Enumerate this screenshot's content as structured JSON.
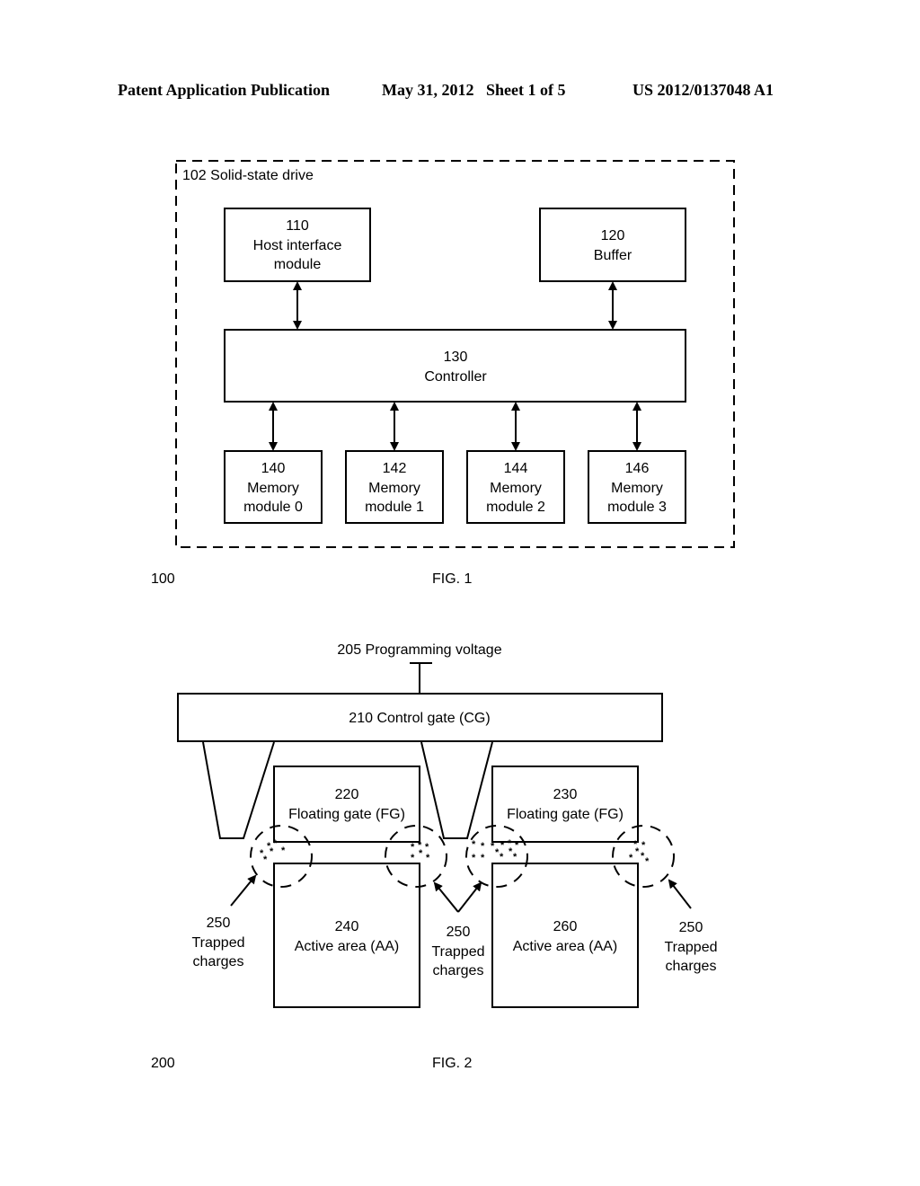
{
  "header": {
    "publication": "Patent Application Publication",
    "date_sheet": "May 31, 2012   Sheet 1 of 5",
    "number": "US 2012/0137048 A1"
  },
  "fig1": {
    "container_label": "102 Solid-state drive",
    "host_interface": {
      "num": "110",
      "line1": "Host interface",
      "line2": "module"
    },
    "buffer": {
      "num": "120",
      "label": "Buffer"
    },
    "controller": {
      "num": "130",
      "label": "Controller"
    },
    "memory_modules": [
      {
        "num": "140",
        "line1": "Memory",
        "line2": "module 0"
      },
      {
        "num": "142",
        "line1": "Memory",
        "line2": "module 1"
      },
      {
        "num": "144",
        "line1": "Memory",
        "line2": "module 2"
      },
      {
        "num": "146",
        "line1": "Memory",
        "line2": "module 3"
      }
    ],
    "ref_number": "100",
    "caption": "FIG. 1"
  },
  "fig2": {
    "programming_voltage": "205 Programming voltage",
    "control_gate": "210 Control gate (CG)",
    "floating_gates": [
      {
        "num": "220",
        "label": "Floating gate (FG)"
      },
      {
        "num": "230",
        "label": "Floating gate (FG)"
      }
    ],
    "active_areas": [
      {
        "num": "240",
        "label": "Active area (AA)"
      },
      {
        "num": "260",
        "label": "Active area (AA)"
      }
    ],
    "trapped_charges": [
      {
        "num": "250",
        "line1": "Trapped",
        "line2": "charges"
      },
      {
        "num": "250",
        "line1": "Trapped",
        "line2": "charges"
      },
      {
        "num": "250",
        "line1": "Trapped",
        "line2": "charges"
      }
    ],
    "charge_glyph": "*",
    "ref_number": "200",
    "caption": "FIG. 2"
  }
}
